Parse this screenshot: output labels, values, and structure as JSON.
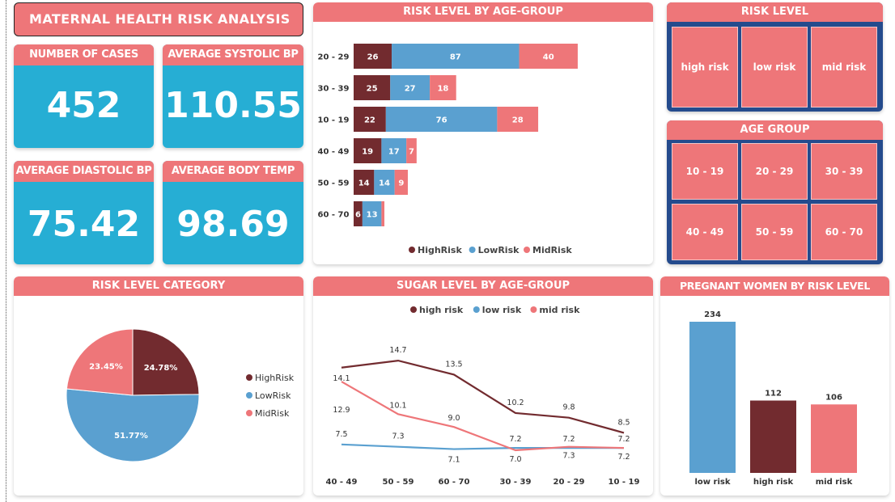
{
  "title": "MATERNAL HEALTH RISK ANALYSIS",
  "kpis": {
    "cases": {
      "label": "NUMBER OF CASES",
      "value": "452"
    },
    "systolic": {
      "label": "AVERAGE SYSTOLIC BP",
      "value": "110.55"
    },
    "diastolic": {
      "label": "AVERAGE DIASTOLIC BP",
      "value": "75.42"
    },
    "temp": {
      "label": "AVERAGE BODY TEMP",
      "value": "98.69"
    }
  },
  "slicers": {
    "risk": {
      "title": "RISK LEVEL",
      "items": [
        "high risk",
        "low risk",
        "mid risk"
      ]
    },
    "age": {
      "title": "AGE GROUP",
      "items": [
        "10 - 19",
        "20 - 29",
        "30 - 39",
        "40 - 49",
        "50 - 59",
        "60 - 70"
      ]
    }
  },
  "colors": {
    "high": "#722b2f",
    "low": "#5aa0d0",
    "mid": "#ee7679",
    "kpi_bg": "#26aed4",
    "slicer_bg": "#244b8d"
  },
  "chart_data": [
    {
      "id": "risk_by_age",
      "type": "bar",
      "orientation": "horizontal",
      "stacked": true,
      "title": "RISK LEVEL BY AGE-GROUP",
      "categories": [
        "20 - 29",
        "30 - 39",
        "10 - 19",
        "40 - 49",
        "50 - 59",
        "60 - 70"
      ],
      "series": [
        {
          "name": "HighRisk",
          "values": [
            26,
            25,
            22,
            19,
            14,
            6
          ]
        },
        {
          "name": "LowRisk",
          "values": [
            87,
            27,
            76,
            17,
            14,
            13
          ]
        },
        {
          "name": "MidRisk",
          "values": [
            40,
            18,
            28,
            7,
            9,
            2
          ]
        }
      ],
      "legend": "bottom"
    },
    {
      "id": "risk_category",
      "type": "pie",
      "title": "RISK LEVEL CATEGORY",
      "labels": [
        "HighRisk",
        "LowRisk",
        "MidRisk"
      ],
      "values": [
        24.78,
        51.77,
        23.45
      ],
      "value_labels": [
        "24.78%",
        "51.77%",
        "23.45%"
      ],
      "legend": "right"
    },
    {
      "id": "sugar_by_age",
      "type": "line",
      "title": "SUGAR LEVEL BY AGE-GROUP",
      "categories": [
        "40 - 49",
        "50 - 59",
        "60 - 70",
        "30 - 39",
        "20 - 29",
        "10 - 19"
      ],
      "series": [
        {
          "name": "high risk",
          "values": [
            14.1,
            14.7,
            13.5,
            10.2,
            9.8,
            8.5
          ]
        },
        {
          "name": "low risk",
          "values": [
            7.5,
            7.3,
            7.1,
            7.2,
            7.2,
            7.2
          ]
        },
        {
          "name": "mid risk",
          "values": [
            12.9,
            10.1,
            9.0,
            7.0,
            7.3,
            7.2
          ]
        }
      ],
      "legend": "top"
    },
    {
      "id": "women_by_risk",
      "type": "bar",
      "title": "PREGNANT WOMEN BY RISK LEVEL",
      "categories": [
        "low risk",
        "high risk",
        "mid risk"
      ],
      "values": [
        234,
        112,
        106
      ]
    }
  ]
}
